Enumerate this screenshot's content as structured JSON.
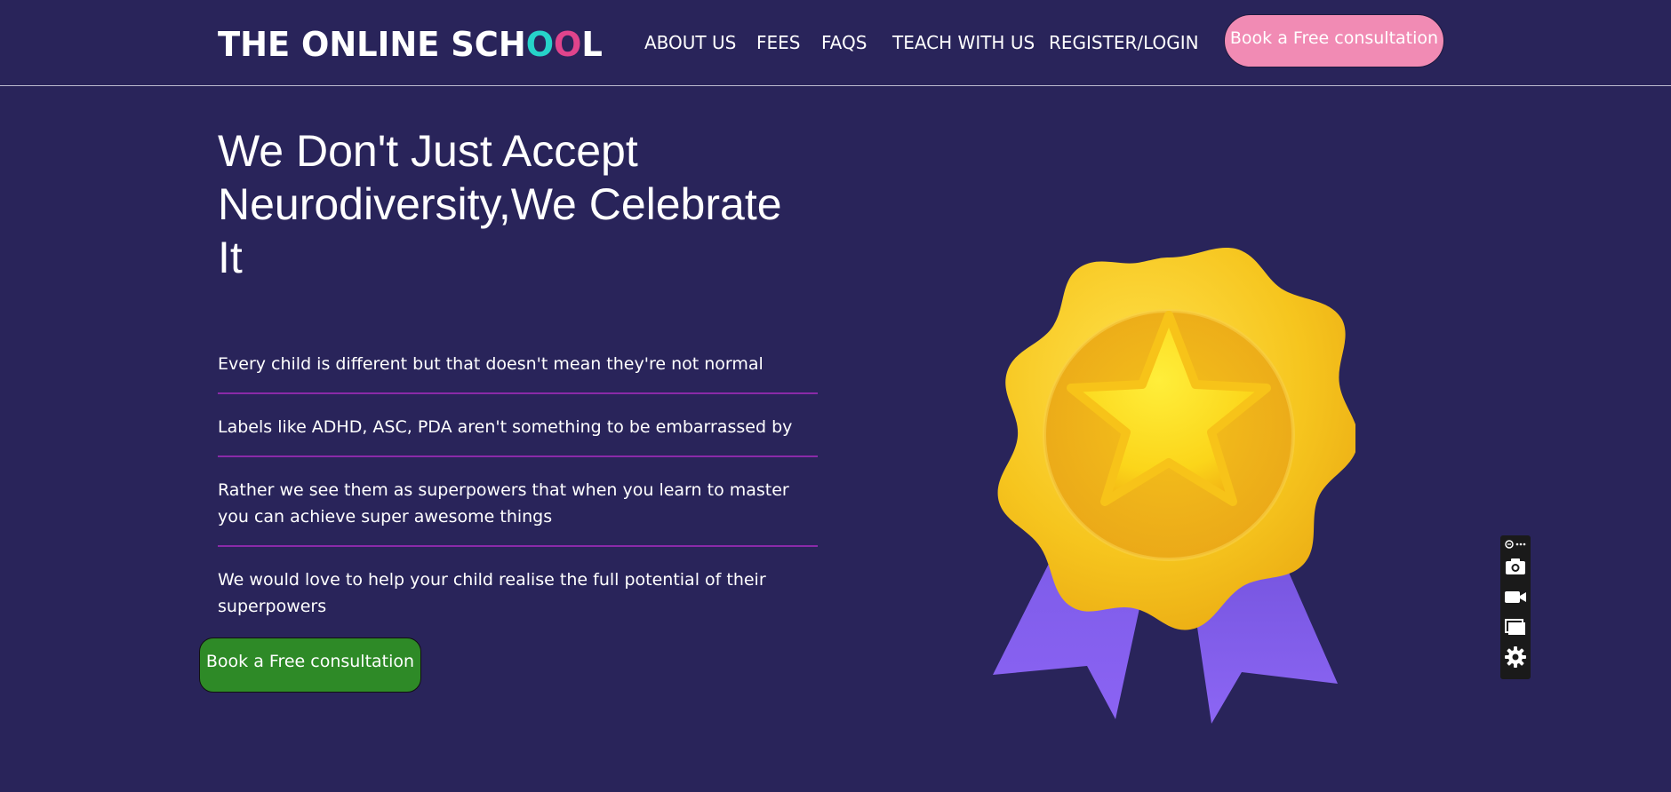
{
  "header": {
    "logo": {
      "part1": "THE ONLINE SCH",
      "o1": "O",
      "o2": "O",
      "part2": "L"
    },
    "nav": [
      "ABOUT US",
      "FEES",
      "FAQS",
      "TEACH WITH US",
      "REGISTER/LOGIN"
    ],
    "cta_label": "Book a Free consultation"
  },
  "hero": {
    "title_line1": "We Don't Just Accept",
    "title_line2": "Neurodiversity,We Celebrate",
    "title_line3": "It",
    "points": [
      "Every child is different but that doesn't mean they're not normal",
      "Labels like ADHD, ASC, PDA aren't something to be embarrassed by",
      "Rather we see them as superpowers that when you learn to master you can achieve super awesome things",
      "We would love to help your child realise the full potential of their superpowers"
    ],
    "cta_label": "Book a Free consultation"
  },
  "illustration": {
    "icon": "medal-icon"
  },
  "toolbar": {
    "items": [
      "extension-icon",
      "more-icon",
      "camera-icon",
      "video-icon",
      "window-icon",
      "gear-icon"
    ]
  },
  "colors": {
    "background": "#29245a",
    "top_cta": "#f18bb4",
    "main_cta": "#2e8a27",
    "divider": "#8a2aa8",
    "logo_o1": "#26d3c9",
    "logo_o2": "#e0448c"
  }
}
